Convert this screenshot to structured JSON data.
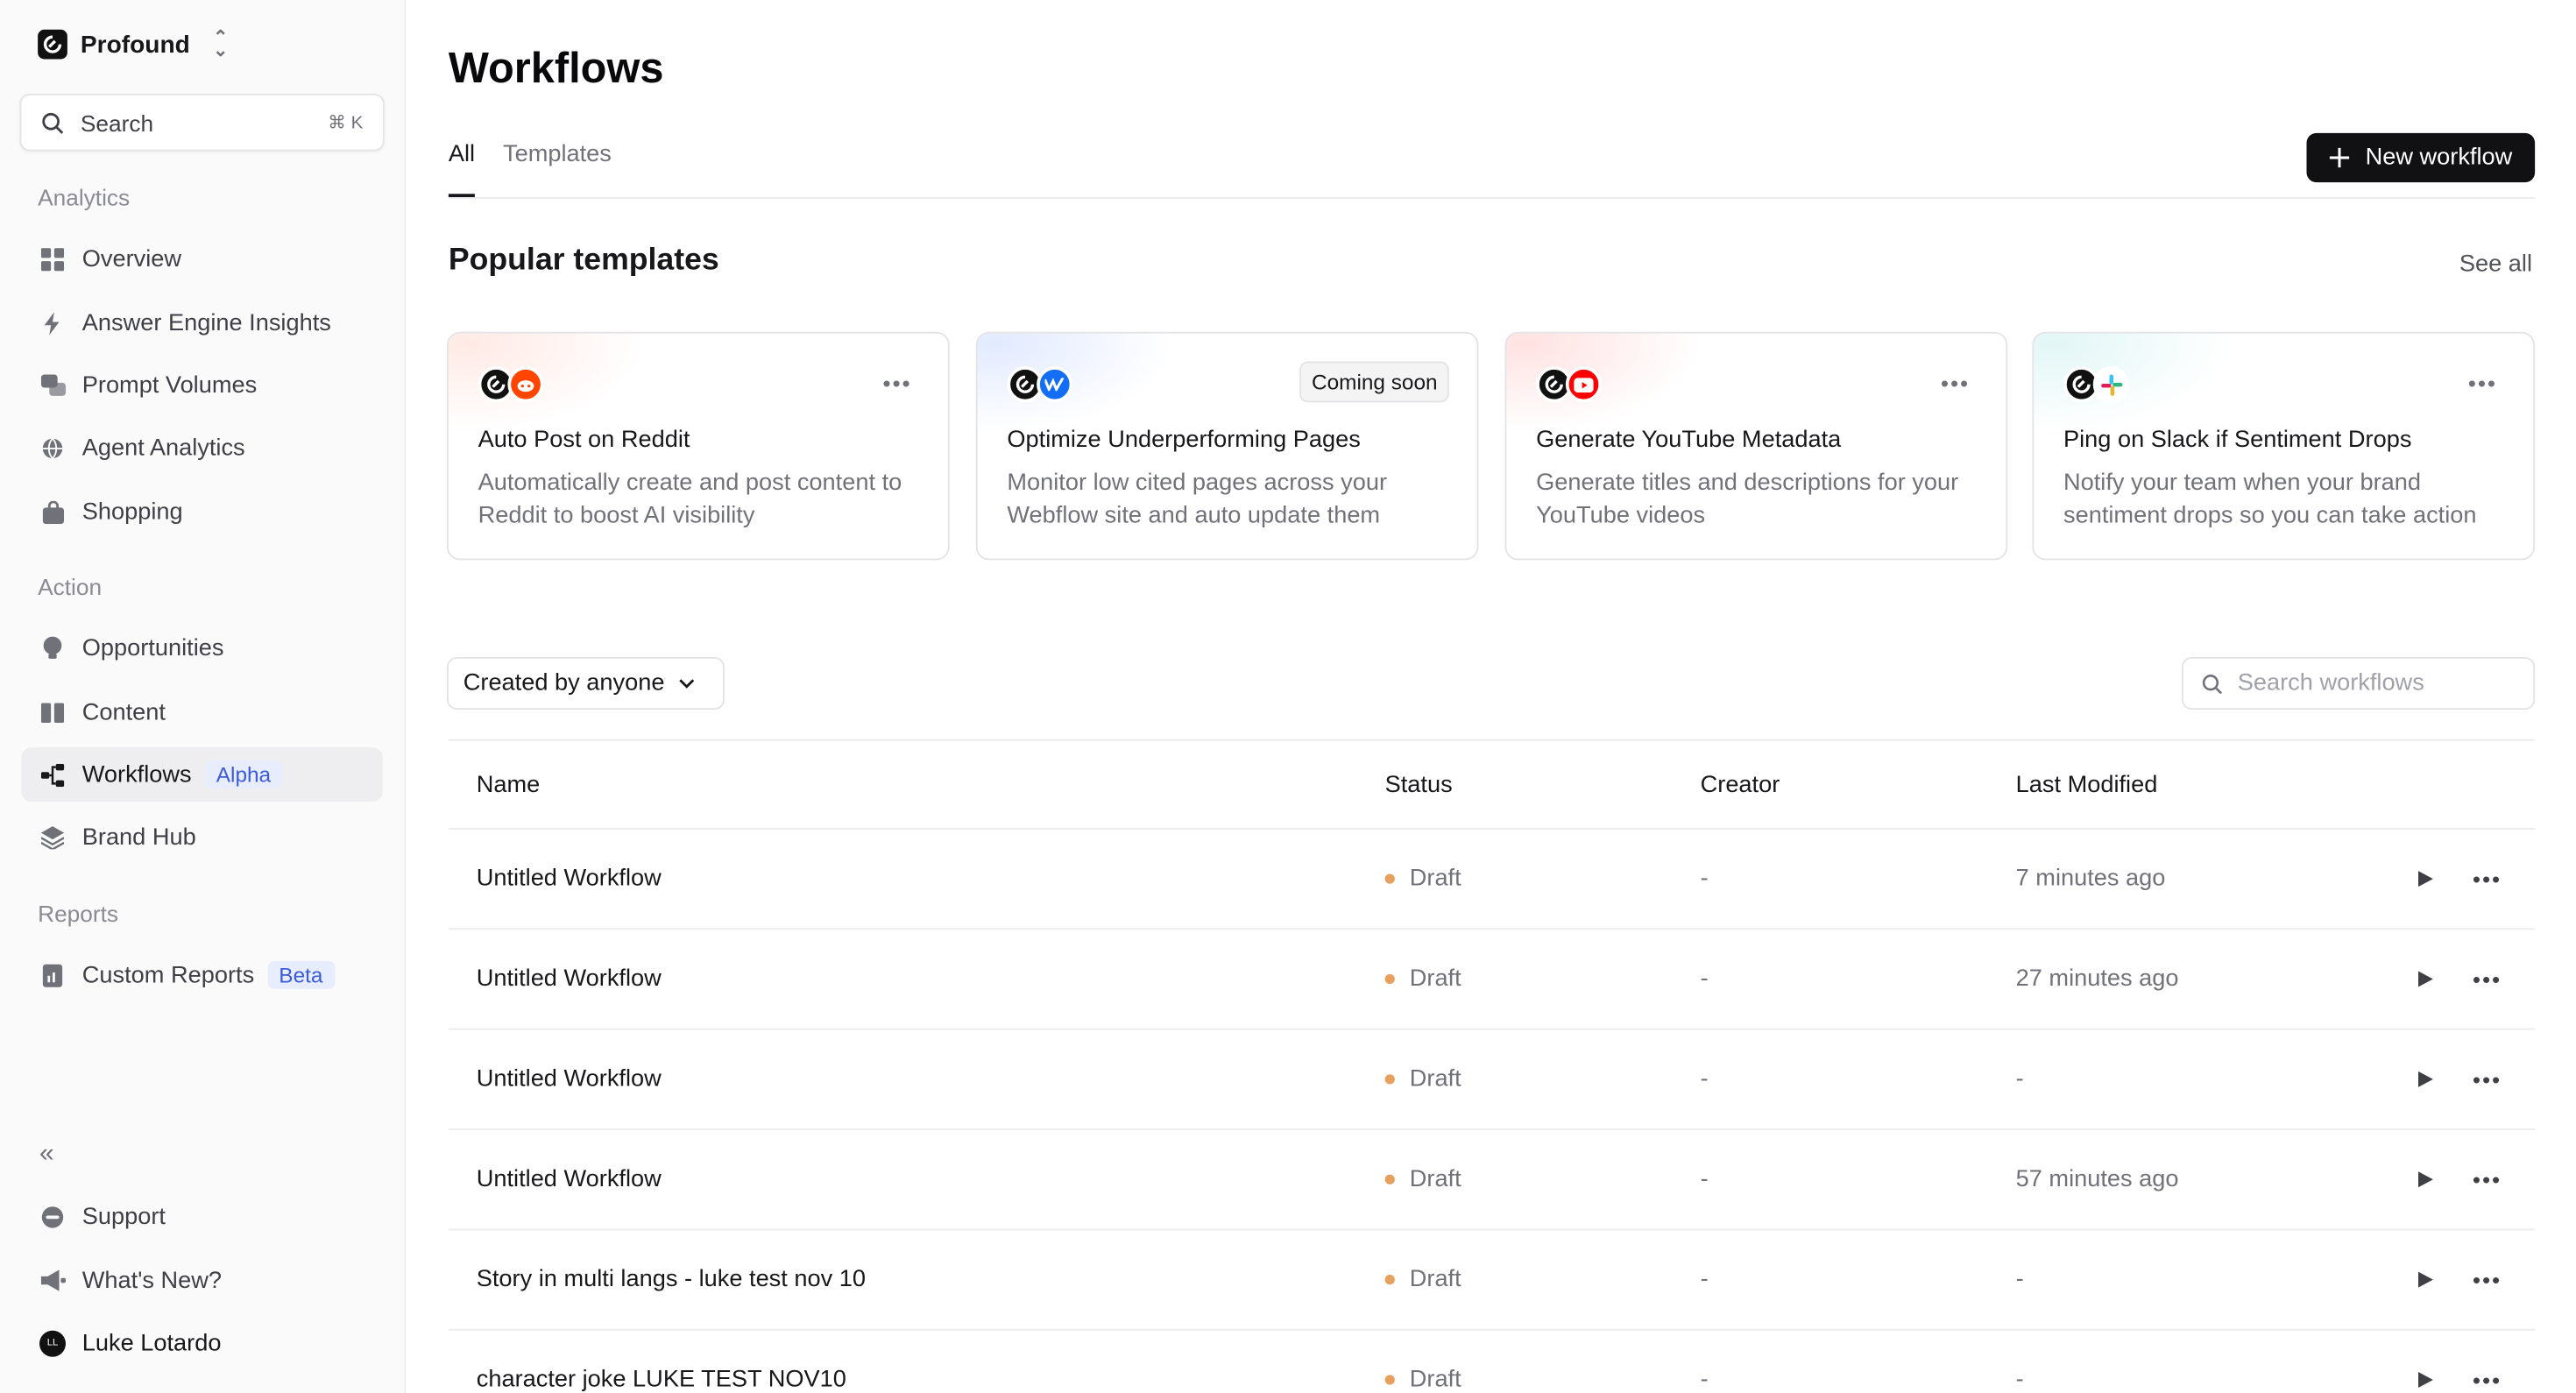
{
  "sidebar": {
    "org_name": "Profound",
    "search": {
      "label": "Search",
      "shortcut": "⌘ K"
    },
    "sections": {
      "analytics": "Analytics",
      "action": "Action",
      "reports": "Reports"
    },
    "items": [
      {
        "label": "Overview",
        "icon": "grid-icon"
      },
      {
        "label": "Answer Engine Insights",
        "icon": "lightning-icon"
      },
      {
        "label": "Prompt Volumes",
        "icon": "chat-icon"
      },
      {
        "label": "Agent Analytics",
        "icon": "globe-icon"
      },
      {
        "label": "Shopping",
        "icon": "bag-icon"
      },
      {
        "label": "Opportunities",
        "icon": "lightbulb-icon"
      },
      {
        "label": "Content",
        "icon": "book-icon"
      },
      {
        "label": "Workflows",
        "icon": "workflow-icon",
        "badge": "Alpha"
      },
      {
        "label": "Brand Hub",
        "icon": "layers-icon"
      },
      {
        "label": "Custom Reports",
        "icon": "report-icon",
        "badge": "Beta"
      }
    ],
    "bottom": {
      "collapse": "«",
      "support": "Support",
      "whats_new": "What's New?",
      "user": "Luke Lotardo",
      "user_initials": "LL"
    }
  },
  "header": {
    "title": "Workflows",
    "tabs": [
      "All",
      "Templates"
    ],
    "new_button": "New workflow"
  },
  "templates": {
    "heading": "Popular templates",
    "see_all": "See all",
    "cards": [
      {
        "title": "Auto Post on Reddit",
        "desc": "Automatically create and post content to Reddit to boost AI visibility",
        "integration": "reddit-icon"
      },
      {
        "title": "Optimize Underperforming Pages",
        "desc": "Monitor low cited pages across your Webflow site and auto update them",
        "integration": "webflow-icon",
        "tag": "Coming soon"
      },
      {
        "title": "Generate YouTube Metadata",
        "desc": "Generate titles and descriptions for your YouTube videos",
        "integration": "youtube-icon"
      },
      {
        "title": "Ping on Slack if Sentiment Drops",
        "desc": "Notify your team when your brand sentiment drops so you can take action",
        "integration": "slack-icon"
      }
    ]
  },
  "filters": {
    "created_by": "Created by anyone",
    "search_placeholder": "Search workflows"
  },
  "table": {
    "columns": [
      "Name",
      "Status",
      "Creator",
      "Last Modified"
    ],
    "rows": [
      {
        "name": "Untitled Workflow",
        "status": "Draft",
        "creator": "-",
        "modified": "7 minutes ago"
      },
      {
        "name": "Untitled Workflow",
        "status": "Draft",
        "creator": "-",
        "modified": "27 minutes ago"
      },
      {
        "name": "Untitled Workflow",
        "status": "Draft",
        "creator": "-",
        "modified": "-"
      },
      {
        "name": "Untitled Workflow",
        "status": "Draft",
        "creator": "-",
        "modified": "57 minutes ago"
      },
      {
        "name": "Story in multi langs - luke test nov 10",
        "status": "Draft",
        "creator": "-",
        "modified": "-"
      },
      {
        "name": "character joke LUKE TEST NOV10",
        "status": "Draft",
        "creator": "-",
        "modified": "-"
      }
    ]
  },
  "colors": {
    "draft_dot": "#e8a05e",
    "primary_button": "#111113",
    "badge_bg": "#e8edfd",
    "badge_text": "#3b5bdb"
  }
}
